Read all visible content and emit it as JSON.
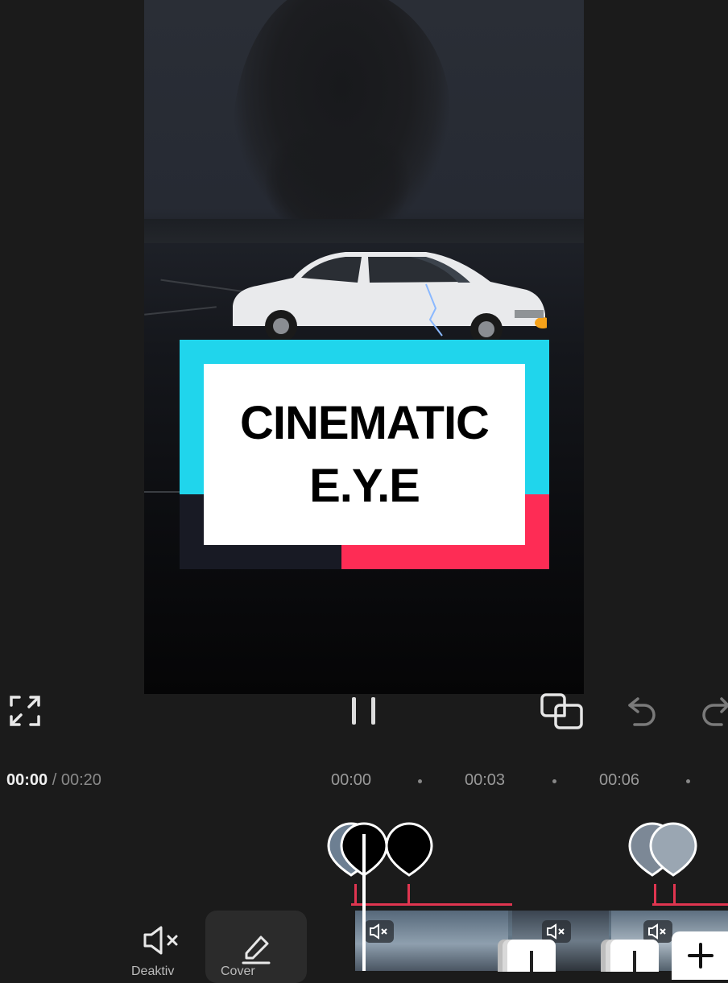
{
  "preview": {
    "logo": {
      "line1": "CINEMATIC",
      "line2": "E.Y.E"
    }
  },
  "controls": {
    "fullscreen_icon": "fullscreen-icon",
    "pause_icon": "pause-icon",
    "keyframe_icon": "keyframe-icon",
    "undo_icon": "undo-icon",
    "redo_icon": "redo-icon"
  },
  "timeline": {
    "current_time": "00:00",
    "separator": " / ",
    "total_time": "00:20",
    "ruler": [
      "00:00",
      "00:03",
      "00:06"
    ]
  },
  "tools": {
    "mute_label": "Deaktiv",
    "edit_label": "Cover"
  },
  "colors": {
    "cyan": "#20d5ec",
    "red": "#fe2c55",
    "track_red": "#e03550",
    "background": "#1b1b1b"
  }
}
